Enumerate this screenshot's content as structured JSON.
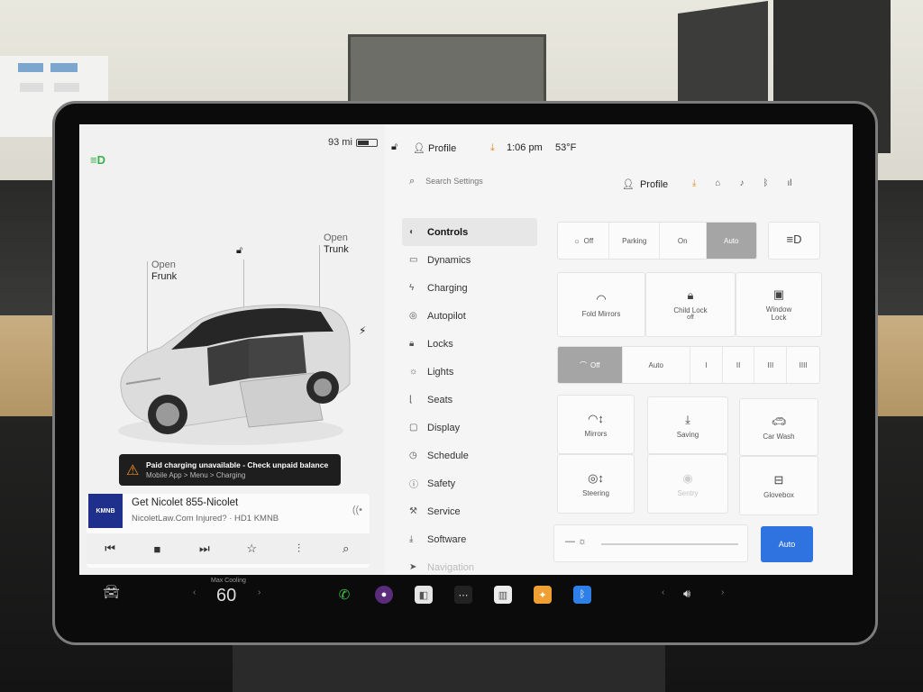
{
  "status": {
    "range": "93 mi",
    "profile": "Profile",
    "time": "1:06 pm",
    "temperature": "53°F"
  },
  "car": {
    "frunk": {
      "line1": "Open",
      "line2": "Frunk"
    },
    "trunk": {
      "line1": "Open",
      "line2": "Trunk"
    }
  },
  "alert": {
    "title": "Paid charging unavailable - Check unpaid balance",
    "subtitle": "Mobile App > Menu > Charging"
  },
  "media": {
    "title": "Get Nicolet 855-Nicolet",
    "subtitle": "NicoletLaw.Com Injured? · HD1 KMNB"
  },
  "settings": {
    "search_placeholder": "Search Settings",
    "profile": "Profile",
    "menu": [
      {
        "label": "Controls",
        "icon": "toggle-icon"
      },
      {
        "label": "Dynamics",
        "icon": "car-icon"
      },
      {
        "label": "Charging",
        "icon": "bolt-icon"
      },
      {
        "label": "Autopilot",
        "icon": "steering-wheel-icon"
      },
      {
        "label": "Locks",
        "icon": "lock-icon"
      },
      {
        "label": "Lights",
        "icon": "sun-icon"
      },
      {
        "label": "Seats",
        "icon": "seat-icon"
      },
      {
        "label": "Display",
        "icon": "display-icon"
      },
      {
        "label": "Schedule",
        "icon": "clock-icon"
      },
      {
        "label": "Safety",
        "icon": "info-icon"
      },
      {
        "label": "Service",
        "icon": "wrench-icon"
      },
      {
        "label": "Software",
        "icon": "download-icon"
      },
      {
        "label": "Navigation",
        "icon": "navigation-icon"
      }
    ],
    "lights": {
      "options": [
        "Off",
        "Parking",
        "On",
        "Auto"
      ],
      "selected": "Auto"
    },
    "tiles_row1": [
      {
        "label": "Fold Mirrors",
        "sub": "",
        "icon": "mirror-icon"
      },
      {
        "label": "Child Lock",
        "sub": "off",
        "icon": "child-lock-icon"
      },
      {
        "label": "Window",
        "sub": "Lock",
        "icon": "window-icon"
      }
    ],
    "wipers": {
      "options": [
        "Off",
        "Auto",
        "I",
        "II",
        "III",
        "IIII"
      ],
      "selected": "Off"
    },
    "tiles_row2": [
      {
        "label": "Mirrors",
        "icon": "mirror-adjust-icon"
      },
      {
        "label": "Saving",
        "icon": "download-icon"
      },
      {
        "label": "Car Wash",
        "icon": "car-wash-icon"
      },
      {
        "label": "Steering",
        "icon": "steering-adjust-icon"
      },
      {
        "label": "Sentry",
        "icon": "sentry-icon"
      },
      {
        "label": "Glovebox",
        "icon": "glovebox-icon"
      }
    ],
    "brightness_auto": "Auto"
  },
  "taskbar": {
    "climate_label": "Max Cooling",
    "temperature": "60"
  },
  "colors": {
    "accent_blue": "#2f73e0",
    "light_green": "#35b24a",
    "alert_orange": "#f08a24"
  }
}
